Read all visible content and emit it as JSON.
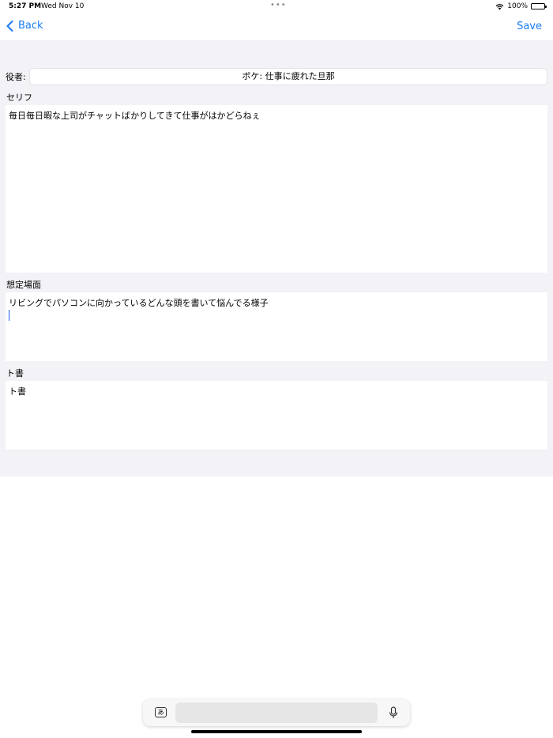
{
  "status_bar": {
    "time": "5:27 PM",
    "date": "Wed Nov 10",
    "battery": "100%"
  },
  "nav": {
    "back_label": "Back",
    "save_label": "Save"
  },
  "form": {
    "actor_label": "役者:",
    "actor_value": "ボケ: 仕事に疲れた旦那",
    "serif_label": "セリフ",
    "serif_text": "毎日毎日暇な上司がチャットばかりしてきて仕事がはかどらねぇ",
    "scene_label": "想定場面",
    "scene_text": "リビングでパソコンに向かっているどんな頭を書いて悩んでる様子",
    "stage_label": "ト書",
    "stage_text": "ト書"
  },
  "keyboard": {
    "ime_label": "あ"
  },
  "colors": {
    "accent": "#1a7cf2",
    "form_background": "#f2f2f7"
  }
}
